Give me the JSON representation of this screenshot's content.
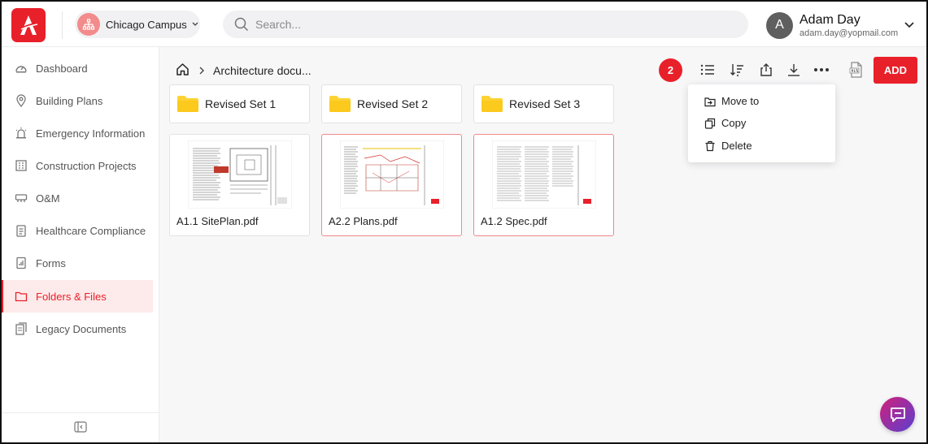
{
  "header": {
    "campus": "Chicago Campus",
    "search_placeholder": "Search...",
    "user_name": "Adam Day",
    "user_email": "adam.day@yopmail.com",
    "user_initial": "A"
  },
  "sidebar": {
    "items": [
      {
        "label": "Dashboard",
        "icon": "dashboard-icon"
      },
      {
        "label": "Building Plans",
        "icon": "location-pin-icon"
      },
      {
        "label": "Emergency Information",
        "icon": "siren-icon"
      },
      {
        "label": "Construction Projects",
        "icon": "building-icon"
      },
      {
        "label": "O&M",
        "icon": "tools-icon"
      },
      {
        "label": "Healthcare Compliance",
        "icon": "clipboard-icon"
      },
      {
        "label": "Forms",
        "icon": "form-icon"
      },
      {
        "label": "Folders & Files",
        "icon": "folder-icon",
        "active": true
      },
      {
        "label": "Legacy Documents",
        "icon": "documents-icon"
      }
    ]
  },
  "main": {
    "breadcrumb": "Architecture docu...",
    "selected_count": "2",
    "add_label": "ADD",
    "folders": [
      {
        "name": "Revised Set 1"
      },
      {
        "name": "Revised Set 2"
      },
      {
        "name": "Revised Set 3"
      }
    ],
    "files": [
      {
        "name": "A1.1 SitePlan.pdf",
        "selected": false
      },
      {
        "name": "A2.2 Plans.pdf",
        "selected": true
      },
      {
        "name": "A1.2 Spec.pdf",
        "selected": true
      }
    ],
    "menu": [
      {
        "label": "Move to",
        "icon": "move-icon"
      },
      {
        "label": "Copy",
        "icon": "copy-icon"
      },
      {
        "label": "Delete",
        "icon": "trash-icon"
      }
    ]
  },
  "colors": {
    "accent": "#e8202a",
    "active_bg": "#fdeaea",
    "folder": "#fdd233"
  }
}
